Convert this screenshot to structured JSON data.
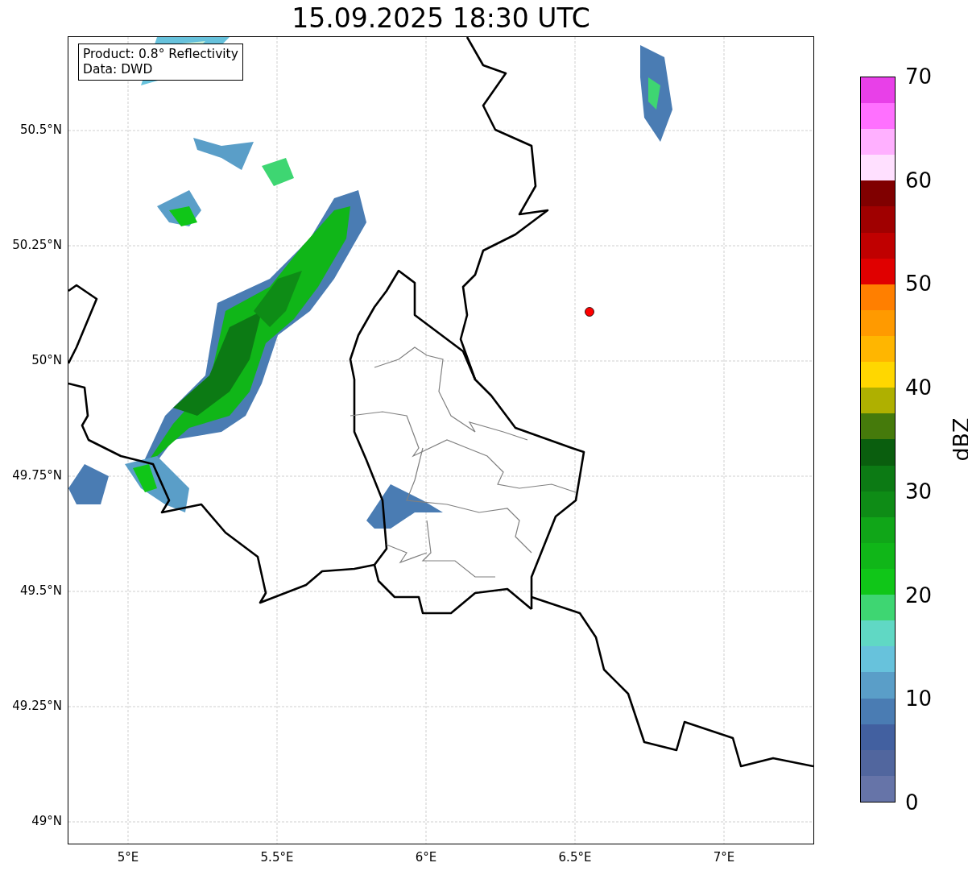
{
  "title": "15.09.2025 18:30 UTC",
  "info_box": {
    "lines": [
      "Product: 0.8° Reflectivity",
      "Data: DWD"
    ]
  },
  "map": {
    "lat_labels": [
      "50.5°N",
      "50.25°N",
      "50°N",
      "49.75°N",
      "49.5°N",
      "49.25°N",
      "49°N"
    ],
    "lon_labels": [
      "5°E",
      "5.5°E",
      "6°E",
      "6.5°E",
      "7°E"
    ]
  },
  "colorbar": {
    "label": "dBZ",
    "ticks": [
      "70",
      "60",
      "50",
      "40",
      "30",
      "20",
      "10",
      "0"
    ],
    "segments": [
      {
        "color": "#6674a8"
      },
      {
        "color": "#51669e"
      },
      {
        "color": "#4260a0"
      },
      {
        "color": "#4a7cb3"
      },
      {
        "color": "#5a9ec8"
      },
      {
        "color": "#67c2dc"
      },
      {
        "color": "#60d8c4"
      },
      {
        "color": "#3ed672"
      },
      {
        "color": "#10c618"
      },
      {
        "color": "#10b618"
      },
      {
        "color": "#10a618"
      },
      {
        "color": "#0e8c16"
      },
      {
        "color": "#0c7a14"
      },
      {
        "color": "#0a5e0e"
      },
      {
        "color": "#457a0b"
      },
      {
        "color": "#afb000"
      },
      {
        "color": "#ffd700"
      },
      {
        "color": "#ffb600"
      },
      {
        "color": "#ff9a00"
      },
      {
        "color": "#ff7f00"
      },
      {
        "color": "#e00000"
      },
      {
        "color": "#c00000"
      },
      {
        "color": "#a00000"
      },
      {
        "color": "#800000"
      },
      {
        "color": "#ffe0ff"
      },
      {
        "color": "#ffb0ff"
      },
      {
        "color": "#ff70ff"
      },
      {
        "color": "#e840e8"
      }
    ]
  }
}
